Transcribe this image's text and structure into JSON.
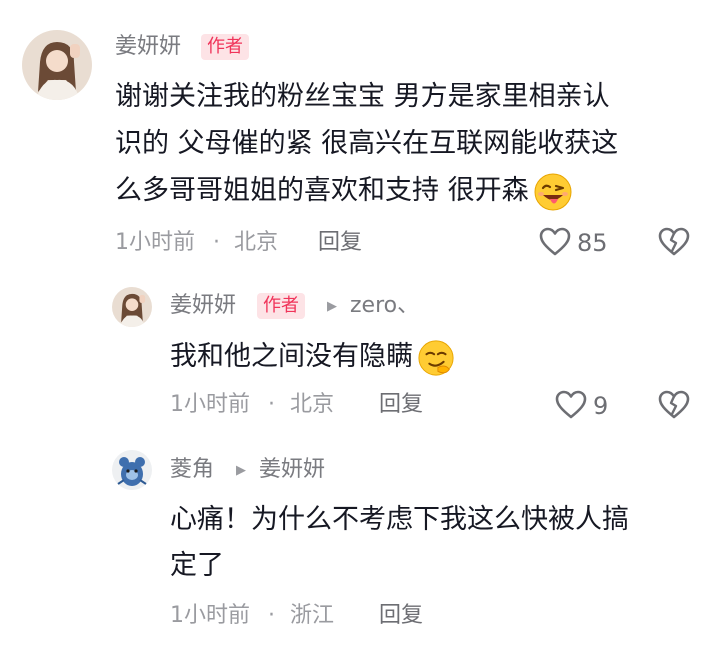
{
  "comments": [
    {
      "username": "姜妍妍",
      "badge": "作者",
      "lines": [
        "谢谢关注我的粉丝宝宝 男方是家里相亲认",
        "识的 父母催的紧 很高兴在互联网能收获这",
        "么多哥哥姐姐的喜欢和支持 很开森"
      ],
      "emoji": "winking-tongue-emoji",
      "time": "1小时前",
      "separator": "·",
      "location": "北京",
      "reply_label": "回复",
      "likes": "85"
    },
    {
      "username": "姜妍妍",
      "badge": "作者",
      "reply_to": "zero、",
      "lines": [
        "我和他之间没有隐瞒"
      ],
      "emoji": "smirking-face-emoji",
      "time": "1小时前",
      "separator": "·",
      "location": "北京",
      "reply_label": "回复",
      "likes": "9"
    },
    {
      "username": "菱角",
      "reply_to": "姜妍妍",
      "lines": [
        "心痛！为什么不考虑下我这么快被人搞",
        "定了"
      ],
      "time": "1小时前",
      "separator": "·",
      "location": "浙江",
      "reply_label": "回复"
    }
  ],
  "colors": {
    "username": "#7a7b80",
    "badge_bg": "#fde3e6",
    "badge_text": "#f0345a",
    "body_text": "#161823",
    "meta": "#9a9ba0"
  },
  "icons": {
    "like": "heart-outline-icon",
    "dislike": "broken-heart-icon",
    "reply_arrow": "caret-right-icon"
  }
}
